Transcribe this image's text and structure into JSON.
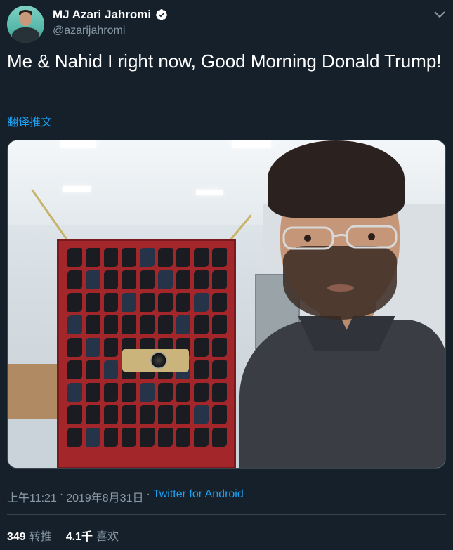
{
  "author": {
    "name": "MJ Azari Jahromi",
    "handle": "@azarijahromi",
    "verified": true
  },
  "tweet": {
    "text": "Me & Nahid I right now, Good Morning Donald Trump!",
    "translate_label": "翻译推文"
  },
  "meta": {
    "time": "上午11:21",
    "separator": "·",
    "date": "2019年8月31日",
    "source": "Twitter for Android"
  },
  "stats": {
    "retweets_count": "349",
    "retweets_label": "转推",
    "likes_count": "4.1千",
    "likes_label": "喜欢"
  },
  "icons": {
    "verified": "verified-badge-icon",
    "menu": "chevron-down-icon"
  },
  "colors": {
    "background": "#15202b",
    "accent": "#1da1f2",
    "secondary_text": "#8899a6"
  }
}
